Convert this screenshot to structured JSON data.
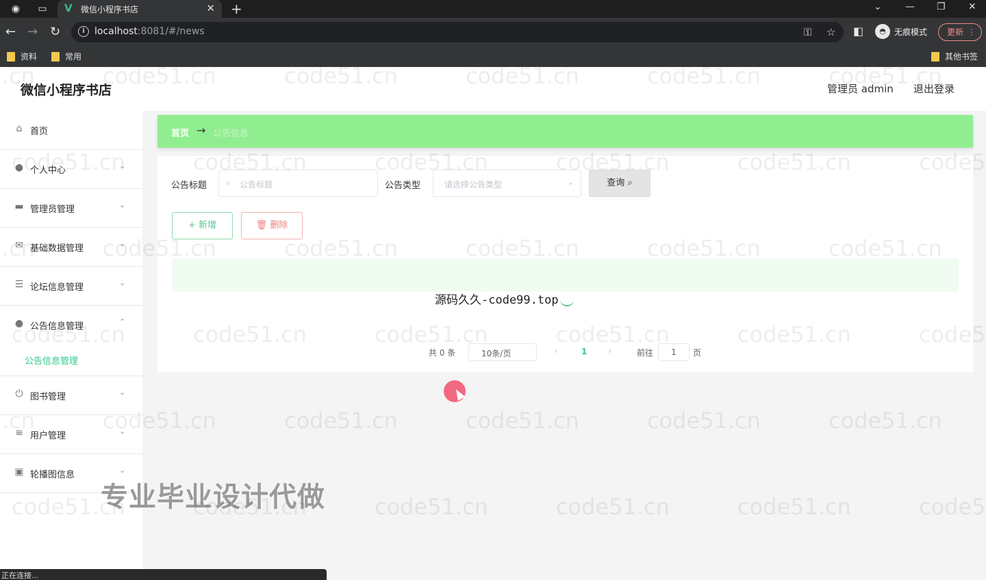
{
  "browser": {
    "tab_title": "微信小程序书店",
    "url_host": "localhost",
    "url_rest": ":8081/#/news",
    "incognito_label": "无痕模式",
    "update_label": "更新",
    "bookmarks": [
      "资料",
      "常用"
    ],
    "other_bookmarks": "其他书签"
  },
  "header": {
    "site_title": "微信小程序书店",
    "admin_label": "管理员 admin",
    "logout_label": "退出登录"
  },
  "sidebar": {
    "items": [
      {
        "label": "首页",
        "icon": "home-icon"
      },
      {
        "label": "个人中心",
        "icon": "user-icon"
      },
      {
        "label": "管理员管理",
        "icon": "admin-icon"
      },
      {
        "label": "基础数据管理",
        "icon": "mail-icon"
      },
      {
        "label": "论坛信息管理",
        "icon": "list-icon"
      },
      {
        "label": "公告信息管理",
        "icon": "user-icon"
      },
      {
        "label": "图书管理",
        "icon": "power-icon"
      },
      {
        "label": "用户管理",
        "icon": "sliders-icon"
      },
      {
        "label": "轮播图信息",
        "icon": "image-icon"
      }
    ],
    "submenu_active": "公告信息管理"
  },
  "breadcrumb": {
    "home": "首页",
    "separator": "→",
    "current": "公告信息"
  },
  "search": {
    "title_label": "公告标题",
    "title_placeholder": "公告标题",
    "type_label": "公告类型",
    "type_placeholder": "请选择公告类型",
    "query_label": "查询"
  },
  "actions": {
    "add_label": "新增",
    "delete_label": "删除"
  },
  "overlay_text": "源码久久-code99.top",
  "pagination": {
    "total": "共 0 条",
    "page_size": "10条/页",
    "current_page": "1",
    "goto_label": "前往",
    "goto_value": "1",
    "page_suffix": "页"
  },
  "promo_text": "专业毕业设计代做",
  "status_text": "正在连接...",
  "watermark": "code51.cn",
  "colors": {
    "breadcrumb_bg": "#90ee90",
    "accent": "#2ec98a",
    "delete": "#f07c7c"
  }
}
